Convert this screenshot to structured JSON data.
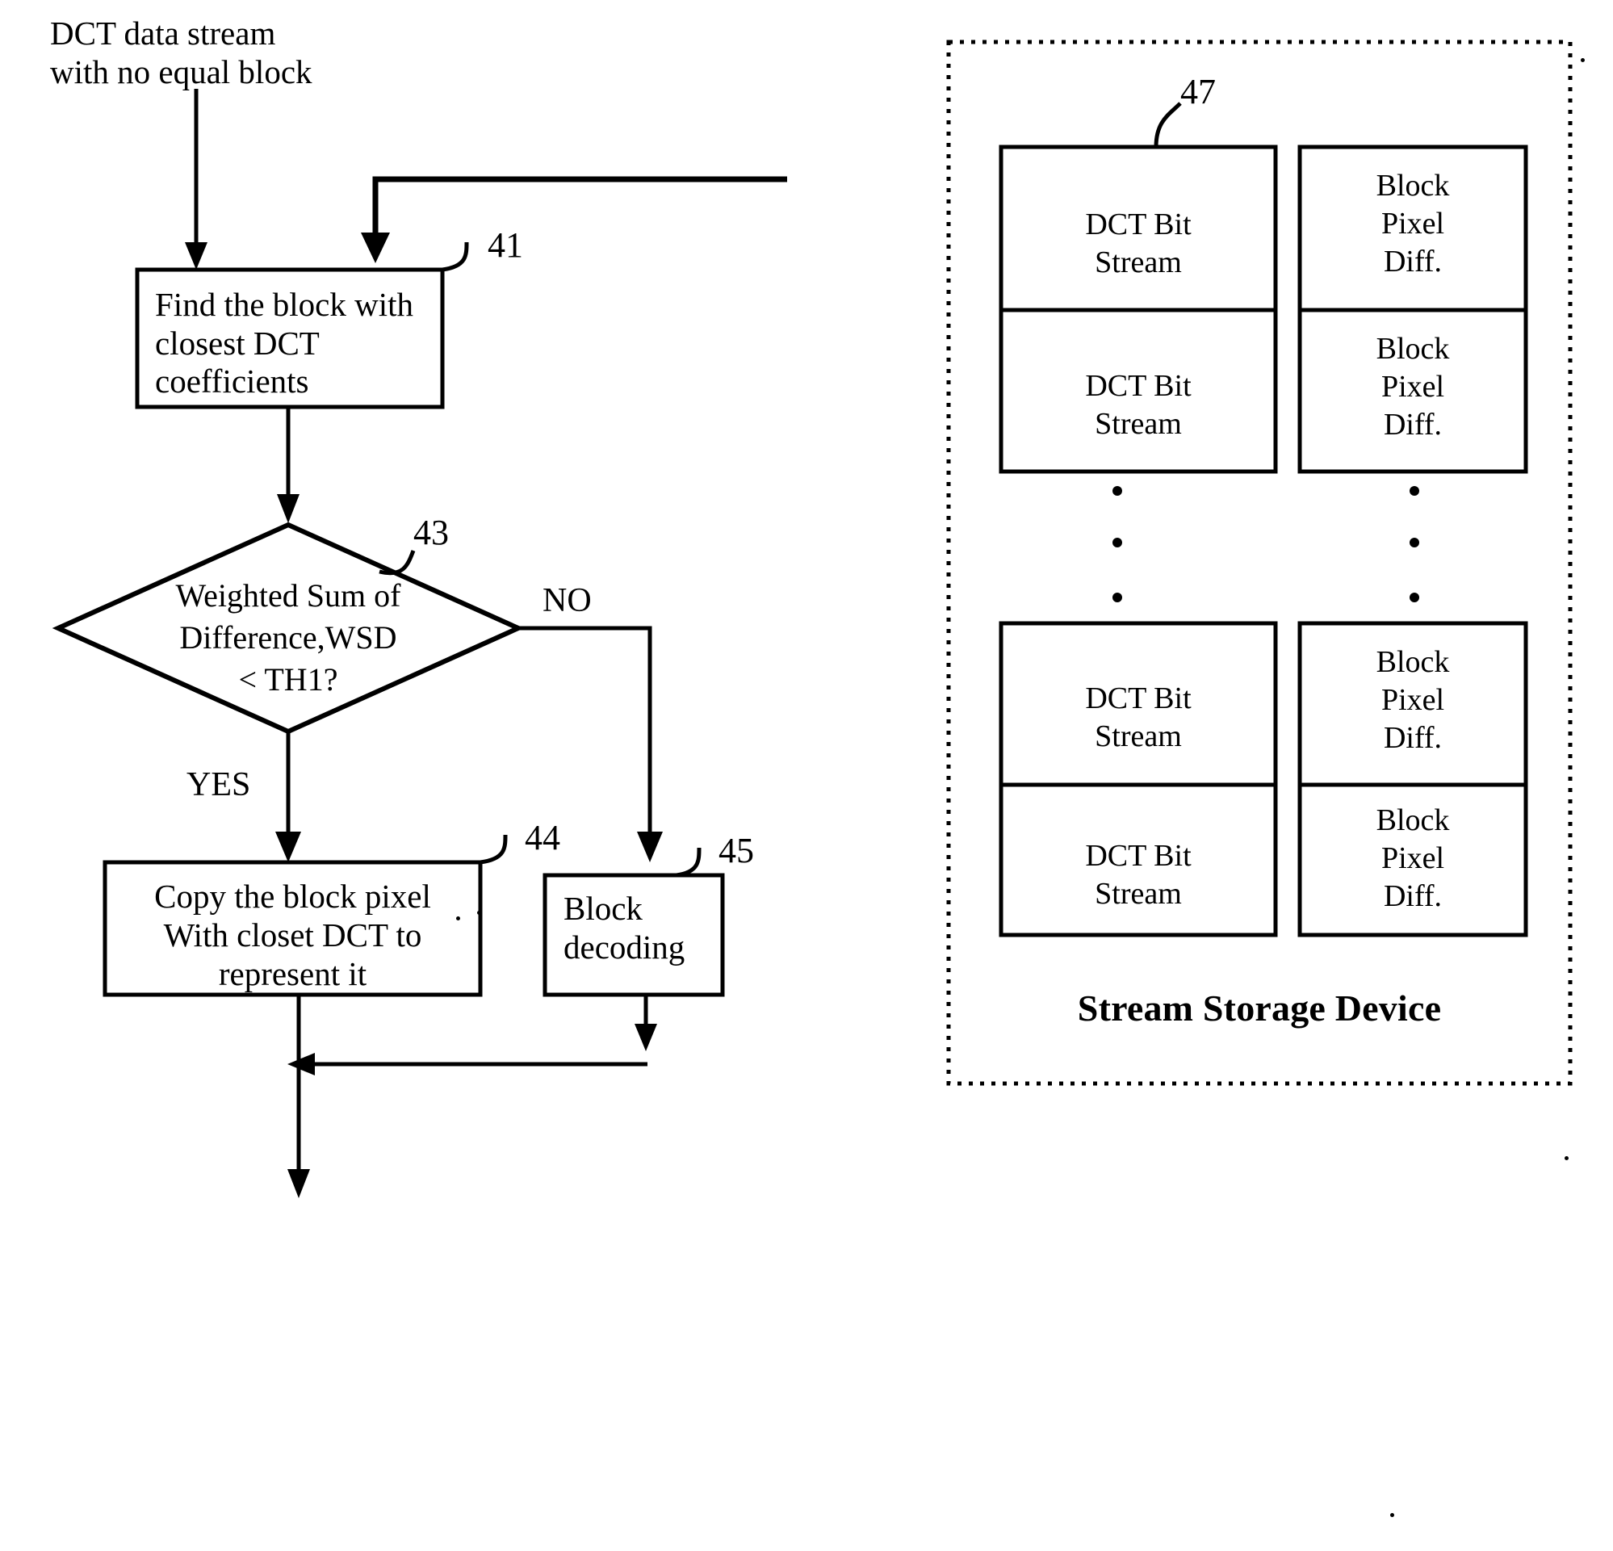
{
  "figure": {
    "type": "patent-flowchart",
    "background_color": "#ffffff",
    "line_color": "#000000"
  },
  "input_caption": {
    "line1": "DCT data stream",
    "line2": "with no equal block"
  },
  "process_41": {
    "ref": "41",
    "line1": "Find the block with",
    "line2": "closest DCT",
    "line3": "coefficients"
  },
  "decision_43": {
    "ref": "43",
    "line1": "Weighted Sum of",
    "line2": "Difference,WSD",
    "line3": "< TH1?",
    "yes_label": "YES",
    "no_label": "NO"
  },
  "process_44": {
    "ref": "44",
    "line1": "Copy the block pixel",
    "line2": "With closet DCT to",
    "line3": "represent it"
  },
  "process_45": {
    "ref": "45",
    "line1": "Block",
    "line2": "decoding"
  },
  "storage_panel": {
    "ref": "47",
    "title": "Stream Storage Device",
    "border_style": "dotted",
    "columns": [
      {
        "name": "dct-bit-stream-column",
        "cells": [
          {
            "line1": "DCT Bit",
            "line2": "Stream"
          },
          {
            "line1": "DCT Bit",
            "line2": "Stream"
          },
          {
            "line1": "DCT Bit",
            "line2": "Stream"
          },
          {
            "line1": "DCT Bit",
            "line2": "Stream"
          }
        ],
        "ellipsis": "vertical-three-dots"
      },
      {
        "name": "block-pixel-diff-column",
        "cells": [
          {
            "line1": "Block",
            "line2": "Pixel",
            "line3": "Diff."
          },
          {
            "line1": "Block",
            "line2": "Pixel",
            "line3": "Diff."
          },
          {
            "line1": "Block",
            "line2": "Pixel",
            "line3": "Diff."
          },
          {
            "line1": "Block",
            "line2": "Pixel",
            "line3": "Diff."
          }
        ],
        "ellipsis": "vertical-three-dots"
      }
    ]
  }
}
